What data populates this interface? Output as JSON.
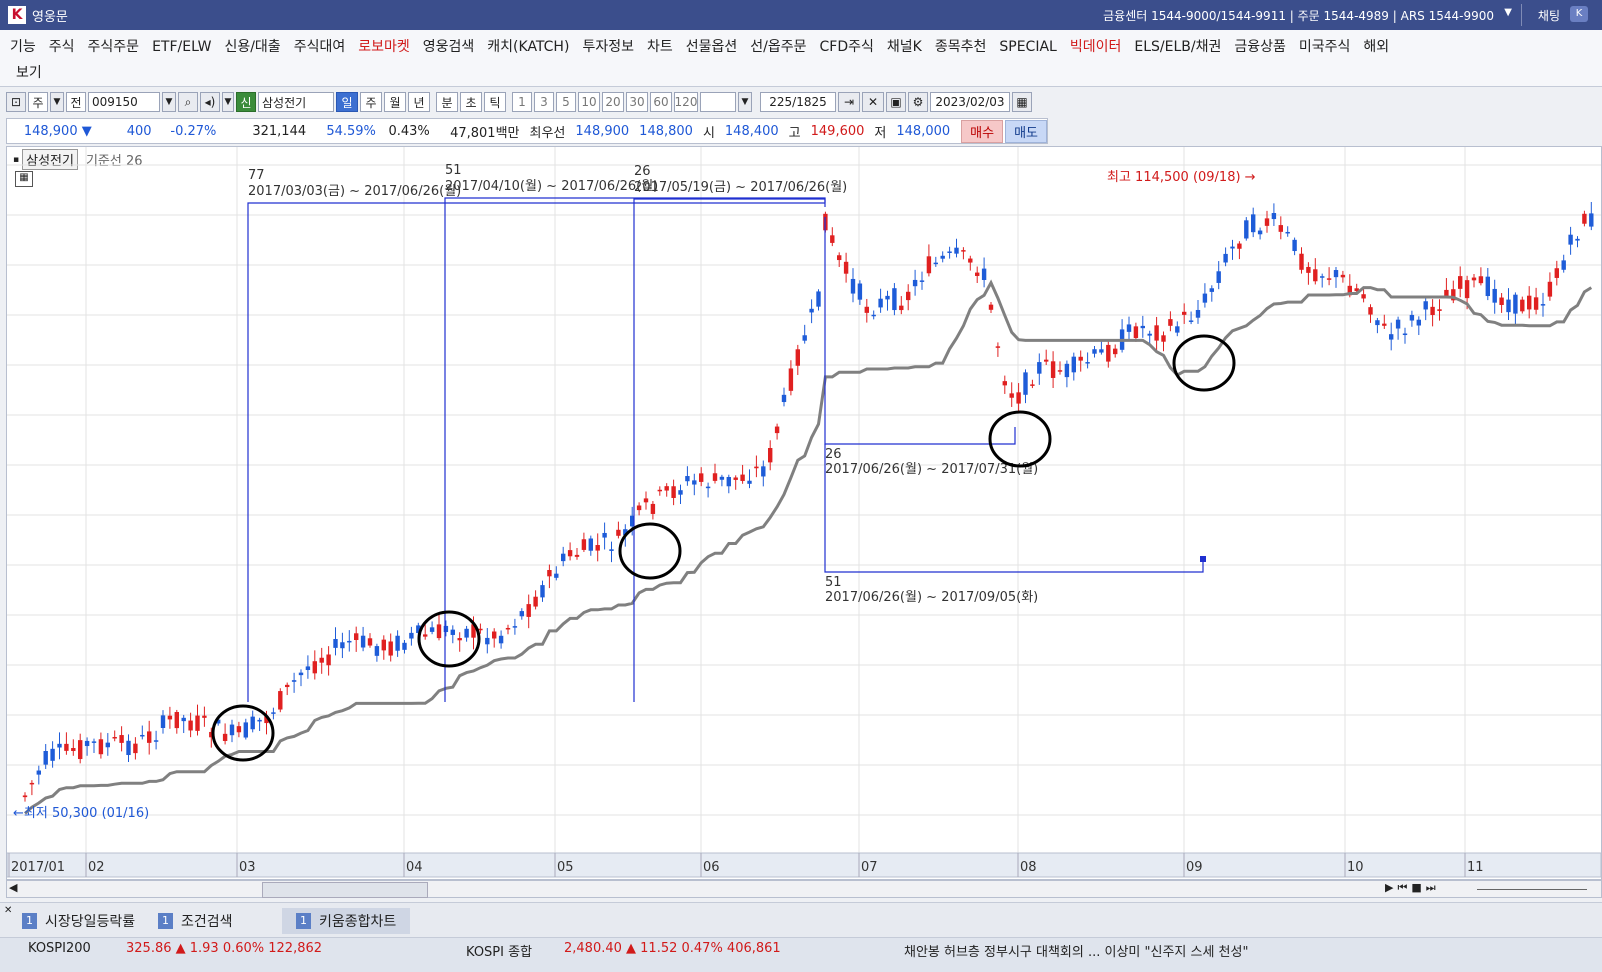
{
  "app": {
    "logo": "K",
    "title": "영웅문",
    "info": "금융센터 1544-9000/1544-9911 | 주문 1544-4989 | ARS 1544-9900",
    "chat": "채팅"
  },
  "menu": {
    "items": [
      {
        "label": "기능",
        "red": false
      },
      {
        "label": "주식",
        "red": false
      },
      {
        "label": "주식주문",
        "red": false
      },
      {
        "label": "ETF/ELW",
        "red": false
      },
      {
        "label": "신용/대출",
        "red": false
      },
      {
        "label": "주식대여",
        "red": false
      },
      {
        "label": "로보마켓",
        "red": true
      },
      {
        "label": "영웅검색",
        "red": false
      },
      {
        "label": "캐치(KATCH)",
        "red": false
      },
      {
        "label": "투자정보",
        "red": false
      },
      {
        "label": "차트",
        "red": false
      },
      {
        "label": "선물옵션",
        "red": false
      },
      {
        "label": "선/옵주문",
        "red": false
      },
      {
        "label": "CFD주식",
        "red": false
      },
      {
        "label": "채널K",
        "red": false
      },
      {
        "label": "종목추천",
        "red": false
      },
      {
        "label": "SPECIAL",
        "red": false
      },
      {
        "label": "빅데이터",
        "red": true
      },
      {
        "label": "ELS/ELB/채권",
        "red": false
      },
      {
        "label": "금융상품",
        "red": false
      },
      {
        "label": "미국주식",
        "red": false
      },
      {
        "label": "해외",
        "red": false
      }
    ],
    "row2": "보기"
  },
  "toolbar": {
    "market": "주",
    "prefix": "전",
    "code": "009150",
    "credit_badge": "신",
    "name": "삼성전기",
    "periods": [
      {
        "label": "일",
        "active": true
      },
      {
        "label": "주",
        "active": false
      },
      {
        "label": "월",
        "active": false
      },
      {
        "label": "년",
        "active": false
      },
      {
        "label": "분",
        "active": false
      },
      {
        "label": "초",
        "active": false
      },
      {
        "label": "틱",
        "active": false
      }
    ],
    "intervals": [
      "1",
      "3",
      "5",
      "10",
      "20",
      "30",
      "60",
      "120"
    ],
    "count": "225",
    "total": "/1825",
    "date": "2023/02/03"
  },
  "quote": {
    "price": "148,900 ▼",
    "change": "400",
    "change_pct": "-0.27%",
    "volume": "321,144",
    "vol_ratio": "54.59%",
    "turnover": "0.43%",
    "amount": "47,801백만",
    "best_label": "최우선",
    "ask": "148,900",
    "bid": "148,800",
    "open_label": "시",
    "open": "148,400",
    "high_label": "고",
    "high": "149,600",
    "low_label": "저",
    "low": "148,000",
    "buy": "매수",
    "sell": "매도"
  },
  "chart_header": {
    "name": "삼성전기",
    "indicator": "기준선 26"
  },
  "chart_data": {
    "type": "candlestick",
    "x_labels": [
      "2017/01",
      "02",
      "03",
      "04",
      "05",
      "06",
      "07",
      "08",
      "09",
      "10",
      "11"
    ],
    "high_marker": "최고 114,500 (09/18)",
    "low_marker": "최저 50,300 (01/16)",
    "annotations": [
      {
        "count": "77",
        "range": "2017/03/03(금) ~ 2017/06/26(월)"
      },
      {
        "count": "51",
        "range": "2017/04/10(월) ~ 2017/06/26(월)"
      },
      {
        "count": "26",
        "range": "2017/05/19(금) ~ 2017/06/26(월)"
      },
      {
        "count": "26",
        "range": "2017/06/26(월) ~ 2017/07/31(월)"
      },
      {
        "count": "51",
        "range": "2017/06/26(월) ~ 2017/09/05(화)"
      }
    ],
    "series": [
      {
        "name": "기준선 26"
      }
    ],
    "colors": {
      "up": "#e02020",
      "down": "#1e5cd8",
      "baseline": "#808080",
      "annotation": "#2030d0"
    }
  },
  "tabs": [
    {
      "badge": "1",
      "label": "시장당일등락률"
    },
    {
      "badge": "1",
      "label": "조건검색"
    },
    {
      "badge": "1",
      "label": "키움종합차트"
    }
  ],
  "ticker": {
    "kospi200": "KOSPI200",
    "kospi200_val": "325.86 ▲ 1.93 0.60% 122,862",
    "kospi": "KOSPI 종합",
    "kospi_val": "2,480.40 ▲ 11.52 0.47% 406,861",
    "news": "채안봉 허브층 정부시구 대책회의 ... 이상미 \"신주지 스세 천성\""
  }
}
